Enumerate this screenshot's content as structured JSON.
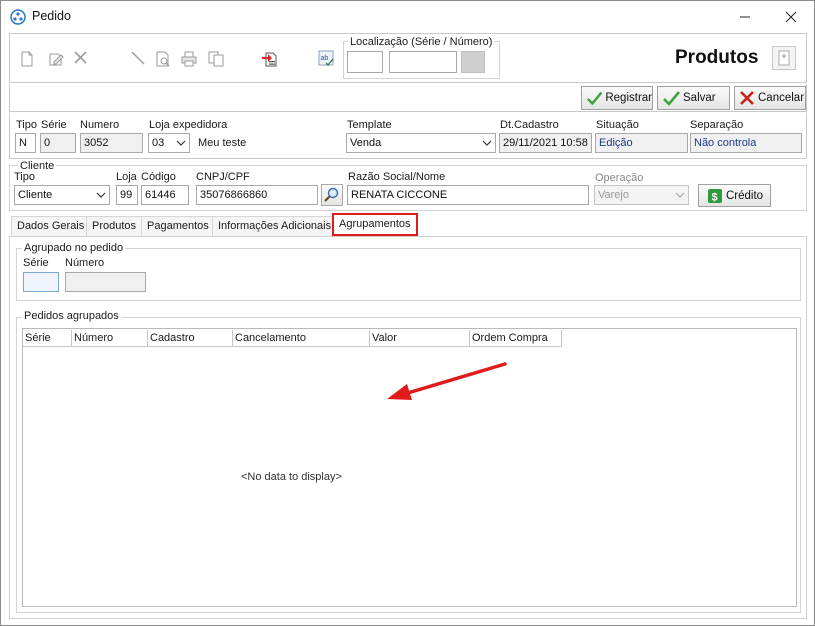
{
  "window": {
    "title": "Pedido",
    "header_title": "Produtos"
  },
  "toolbar": {
    "localizacao_label": "Localização (Série / Número)",
    "localizacao_serie": "",
    "localizacao_numero": ""
  },
  "actions": {
    "registrar": "Registrar",
    "salvar": "Salvar",
    "cancelar": "Cancelar"
  },
  "order": {
    "tipo_label": "Tipo",
    "tipo_value": "N",
    "serie_label": "Série",
    "serie_value": "0",
    "numero_label": "Numero",
    "numero_value": "3052",
    "loja_expedidora_label": "Loja expedidora",
    "loja_expedidora_value": "03",
    "loja_expedidora_name": "Meu teste",
    "template_label": "Template",
    "template_value": "Venda",
    "dt_cadastro_label": "Dt.Cadastro",
    "dt_cadastro_value": "29/11/2021 10:58",
    "situacao_label": "Situação",
    "situacao_value": "Edição",
    "separacao_label": "Separação",
    "separacao_value": "Não controla"
  },
  "cliente": {
    "group_label": "Cliente",
    "tipo_label": "Tipo",
    "tipo_value": "Cliente",
    "loja_label": "Loja",
    "loja_value": "99",
    "codigo_label": "Código",
    "codigo_value": "61446",
    "cnpj_label": "CNPJ/CPF",
    "cnpj_value": "35076866860",
    "razao_label": "Razão Social/Nome",
    "razao_value": "RENATA CICCONE",
    "operacao_label": "Operação",
    "operacao_value": "Varejo",
    "credito_button": "Crédito"
  },
  "tabs": [
    {
      "label": "Dados Gerais"
    },
    {
      "label": "Produtos"
    },
    {
      "label": "Pagamentos"
    },
    {
      "label": "Informações Adicionais"
    },
    {
      "label": "Agrupamentos"
    }
  ],
  "agrupado": {
    "group_label": "Agrupado no pedido",
    "serie_label": "Série",
    "numero_label": "Número",
    "serie_value": "",
    "numero_value": ""
  },
  "pedidos_agrupados": {
    "group_label": "Pedidos agrupados",
    "columns": [
      "Série",
      "Número",
      "Cadastro",
      "Cancelamento",
      "Valor",
      "Ordem Compra"
    ],
    "empty_text": "<No data to display>"
  },
  "colors": {
    "annotation_red": "#e01b1b",
    "check_green": "#3aa53a",
    "cancel_red": "#c8221c"
  }
}
